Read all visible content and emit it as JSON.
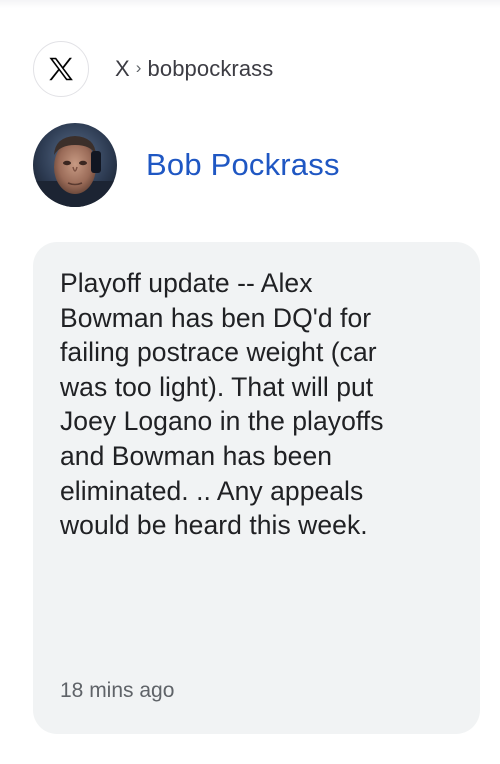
{
  "source": {
    "logo_icon": "x-logo-icon",
    "breadcrumb": {
      "site": "X",
      "separator": "›",
      "handle": "bobpockrass"
    }
  },
  "author": {
    "name": "Bob Pockrass",
    "avatar_icon": "author-avatar"
  },
  "post": {
    "text": "Playoff update -- Alex\nBowman has ben DQ'd for\nfailing postrace weight (car\nwas too light). That will put\nJoey Logano in the playoffs\nand Bowman has been\neliminated. .. Any appeals\nwould be heard this week.",
    "timestamp": "18 mins ago"
  },
  "colors": {
    "author_link": "#1f57c3",
    "card_background": "#f1f3f4",
    "text": "#202124",
    "muted": "#5f6368"
  }
}
